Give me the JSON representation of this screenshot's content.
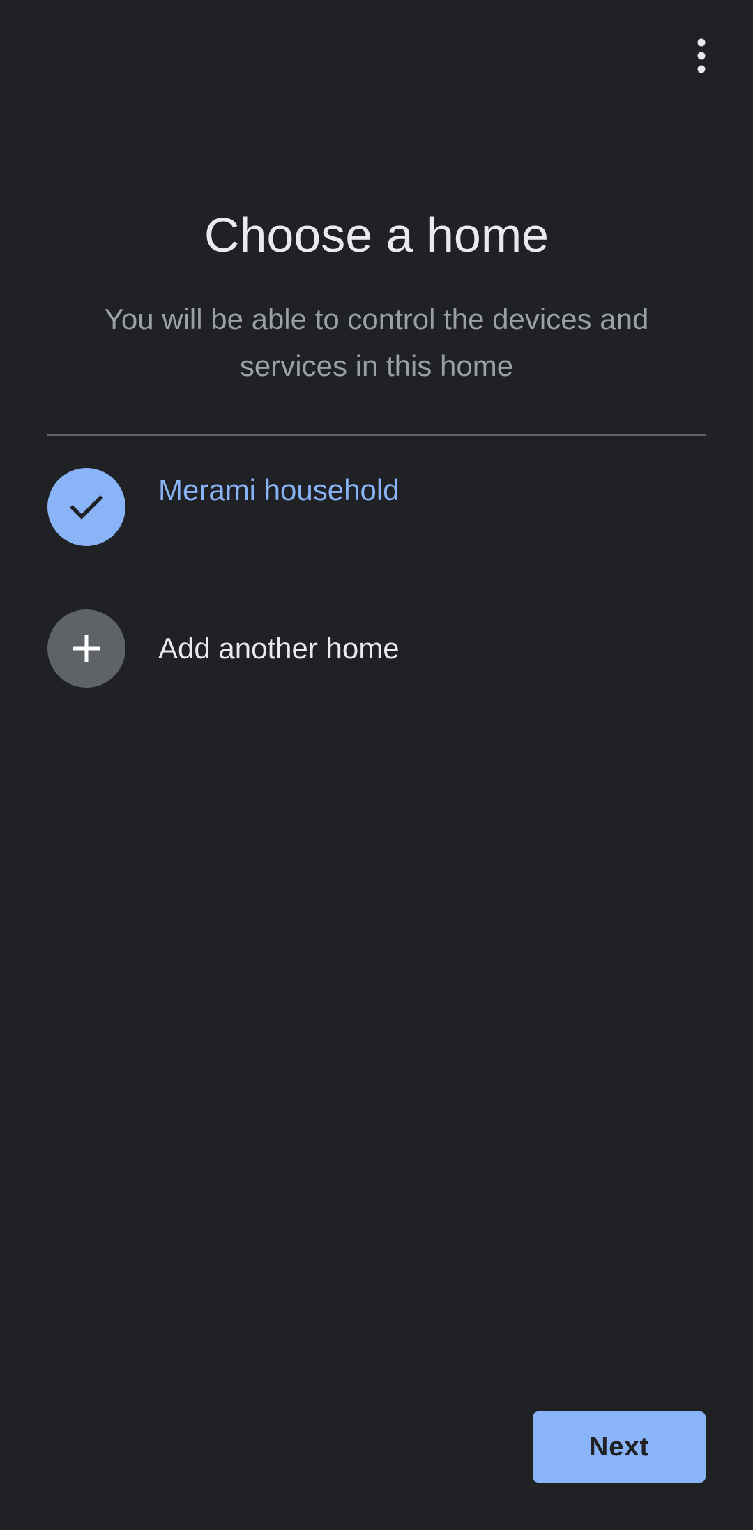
{
  "header": {
    "overflow_icon": "more-vert-icon"
  },
  "main": {
    "title": "Choose a home",
    "subtitle": "You will be able to control the devices and services in this home"
  },
  "homes": [
    {
      "label": "Merami household",
      "selected": true,
      "icon": "check-icon"
    },
    {
      "label": "Add another home",
      "selected": false,
      "icon": "add-icon"
    }
  ],
  "footer": {
    "next_label": "Next"
  },
  "colors": {
    "background": "#202124",
    "accent": "#8ab4f8",
    "text_primary": "#e8eaed",
    "text_secondary": "#9aa0a6",
    "divider": "#5f6368"
  }
}
